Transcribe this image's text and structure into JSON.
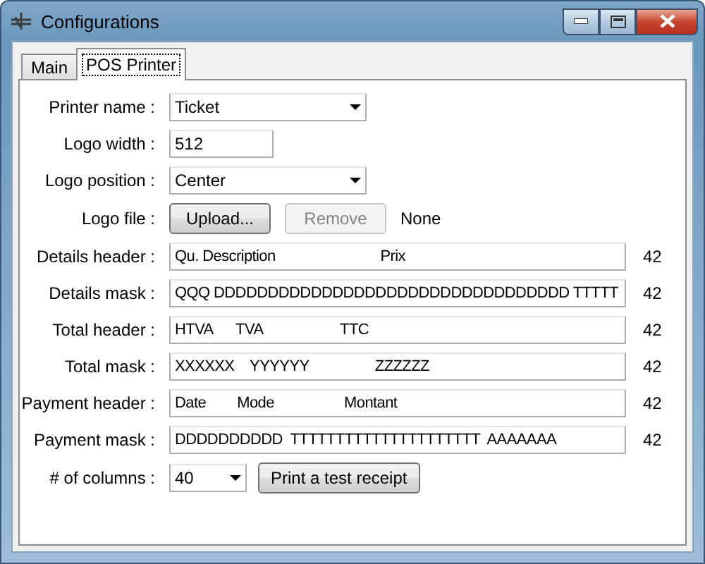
{
  "window": {
    "title": "Configurations"
  },
  "tabs": [
    {
      "label": "Main",
      "selected": false
    },
    {
      "label": "POS Printer",
      "selected": true
    }
  ],
  "fields": [
    {
      "label": "Printer name :",
      "kind": "dropdown",
      "value": "Ticket"
    },
    {
      "label": "Logo width :",
      "kind": "text",
      "value": "512"
    },
    {
      "label": "Logo position :",
      "kind": "dropdown",
      "value": "Center"
    },
    {
      "label": "Logo file :",
      "kind": "file",
      "buttons": [
        {
          "label": "Upload...",
          "disabled": false
        },
        {
          "label": "Remove",
          "disabled": true
        }
      ],
      "status": "None"
    },
    {
      "label": "Details header :",
      "kind": "mask",
      "value": "Qu. Description                           Prix",
      "count": "42"
    },
    {
      "label": "Details mask :",
      "kind": "mask",
      "value": "QQQ DDDDDDDDDDDDDDDDDDDDDDDDDDDDDDDDD TTTTT",
      "count": "42"
    },
    {
      "label": "Total header :",
      "kind": "mask",
      "value": "HTVA      TVA                    TTC",
      "count": "42"
    },
    {
      "label": "Total mask :",
      "kind": "mask",
      "value": "XXXXXX    YYYYYY                 ZZZZZZ",
      "count": "42"
    },
    {
      "label": "Payment header :",
      "kind": "mask",
      "value": "Date        Mode                  Montant",
      "count": "42"
    },
    {
      "label": "Payment mask :",
      "kind": "mask",
      "value": "DDDDDDDDDD  TTTTTTTTTTTTTTTTTTTTT  AAAAAAA",
      "count": "42"
    },
    {
      "label": "# of columns :",
      "kind": "columns",
      "value": "40",
      "button": "Print a test receipt"
    }
  ]
}
